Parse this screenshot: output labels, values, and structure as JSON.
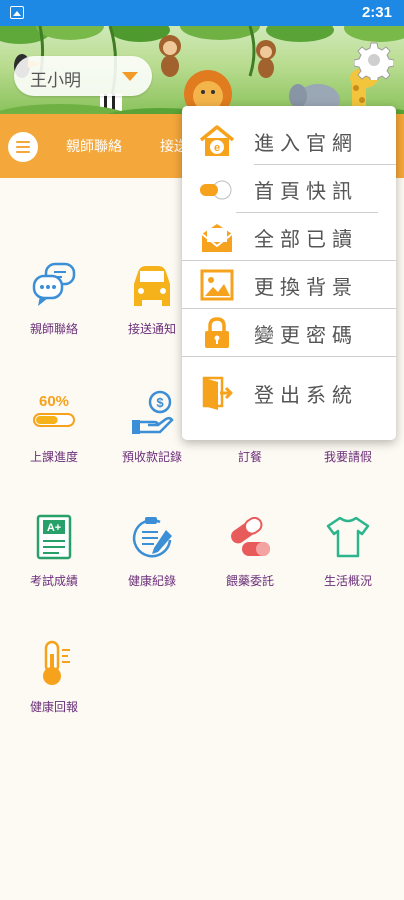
{
  "status_bar": {
    "time": "2:31",
    "left_icon": "image-icon"
  },
  "header": {
    "user_name": "王小明",
    "settings_icon": "gear-icon",
    "menu_icon": "hamburger-icon",
    "tabs": [
      {
        "label": "親師聯絡"
      },
      {
        "label": "接送通知"
      }
    ]
  },
  "grid": [
    {
      "label": "親師聯絡",
      "icon": "chat-bubbles-icon"
    },
    {
      "label": "接送通知",
      "icon": "car-icon"
    },
    {
      "label": "上課進度",
      "icon": "progress-bar-icon",
      "progress_text": "60%",
      "progress": 0.6
    },
    {
      "label": "預收款記錄",
      "icon": "money-hand-icon"
    },
    {
      "label": "訂餐",
      "icon": "meal-icon"
    },
    {
      "label": "我要請假",
      "icon": "leave-icon"
    },
    {
      "label": "考試成績",
      "icon": "report-card-icon"
    },
    {
      "label": "健康紀錄",
      "icon": "clipboard-pen-icon"
    },
    {
      "label": "餵藥委託",
      "icon": "pill-capsule-icon"
    },
    {
      "label": "生活概況",
      "icon": "tshirt-icon"
    },
    {
      "label": "健康回報",
      "icon": "thermometer-icon"
    }
  ],
  "dropdown": {
    "items": [
      {
        "label": "進入官網",
        "icon": "home-e-icon"
      },
      {
        "label": "首頁快訊",
        "icon": "toggle-icon",
        "toggle_on": true
      },
      {
        "label": "全部已讀",
        "icon": "envelope-icon"
      },
      {
        "label": "更換背景",
        "icon": "picture-icon"
      },
      {
        "label": "變更密碼",
        "icon": "lock-icon"
      },
      {
        "label": "登出系統",
        "icon": "logout-door-icon"
      }
    ]
  },
  "colors": {
    "accent_orange": "#f4a73a",
    "label_purple": "#6b2f7a",
    "status_blue": "#1e88e5"
  }
}
